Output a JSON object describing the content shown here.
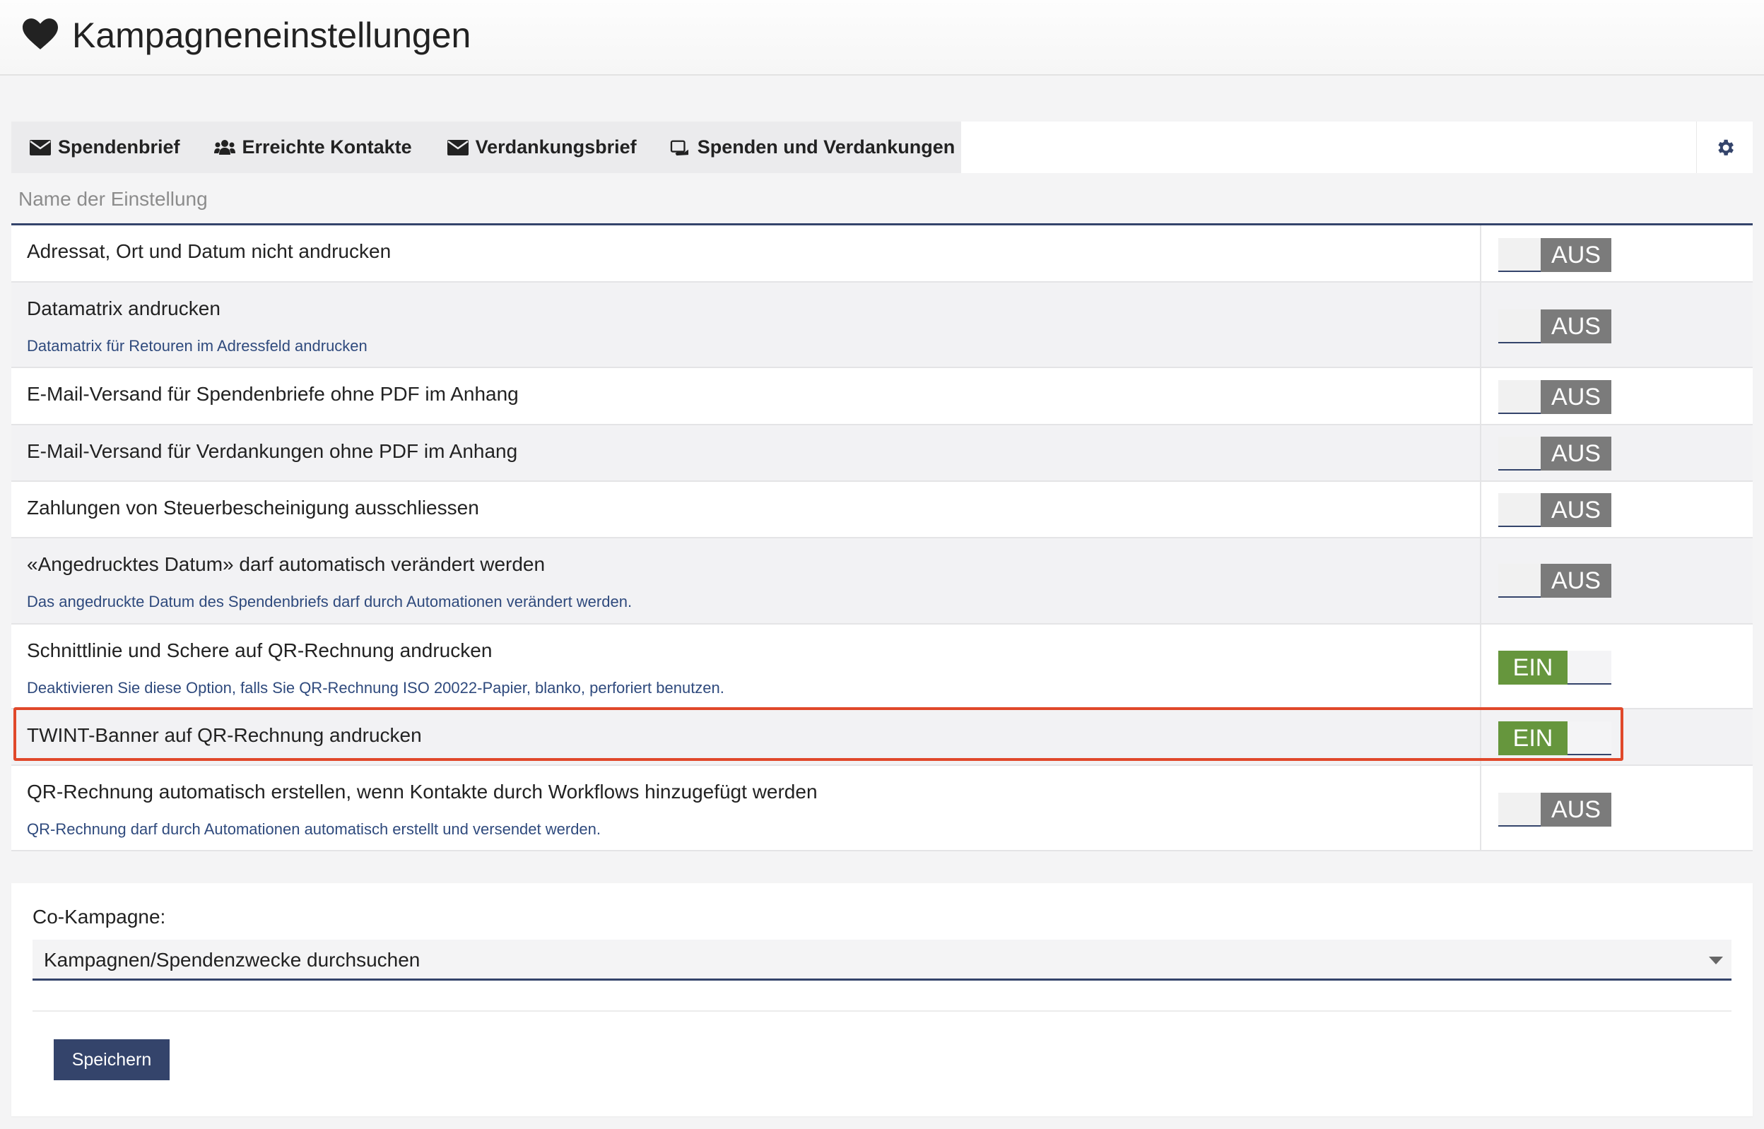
{
  "header": {
    "title": "Kampagneneinstellungen",
    "icon": "heart-icon"
  },
  "tabs": [
    {
      "label": "Spendenbrief",
      "icon": "envelope-icon"
    },
    {
      "label": "Erreichte Kontakte",
      "icon": "users-icon"
    },
    {
      "label": "Verdankungsbrief",
      "icon": "envelope-icon"
    },
    {
      "label": "Spenden und Verdankungen",
      "icon": "donation-icon"
    }
  ],
  "table": {
    "column_header": "Name der Einstellung",
    "rows": [
      {
        "label": "Adressat, Ort und Datum nicht andrucken",
        "desc": "",
        "state": "AUS"
      },
      {
        "label": "Datamatrix andrucken",
        "desc": "Datamatrix für Retouren im Adressfeld andrucken",
        "state": "AUS"
      },
      {
        "label": "E-Mail-Versand für Spendenbriefe ohne PDF im Anhang",
        "desc": "",
        "state": "AUS"
      },
      {
        "label": "E-Mail-Versand für Verdankungen ohne PDF im Anhang",
        "desc": "",
        "state": "AUS"
      },
      {
        "label": "Zahlungen von Steuerbescheinigung ausschliessen",
        "desc": "",
        "state": "AUS"
      },
      {
        "label": "«Angedrucktes Datum» darf automatisch verändert werden",
        "desc": "Das angedruckte Datum des Spendenbriefs darf durch Automationen verändert werden.",
        "state": "AUS"
      },
      {
        "label": "Schnittlinie und Schere auf QR-Rechnung andrucken",
        "desc": "Deaktivieren Sie diese Option, falls Sie QR-Rechnung ISO 20022-Papier, blanko, perforiert benutzen.",
        "state": "EIN"
      },
      {
        "label": "TWINT-Banner auf QR-Rechnung andrucken",
        "desc": "",
        "state": "EIN"
      },
      {
        "label": "QR-Rechnung automatisch erstellen, wenn Kontakte durch Workflows hinzugefügt werden",
        "desc": "QR-Rechnung darf durch Automationen automatisch erstellt und versendet werden.",
        "state": "AUS"
      }
    ]
  },
  "co_campaign": {
    "label": "Co-Kampagne:",
    "placeholder": "Kampagnen/Spendenzwecke durchsuchen"
  },
  "save_label": "Speichern",
  "colors": {
    "accent": "#34446b",
    "on": "#66963d",
    "off": "#7b7b7b",
    "highlight": "#e0482a",
    "desc_text": "#2f4a7d"
  }
}
